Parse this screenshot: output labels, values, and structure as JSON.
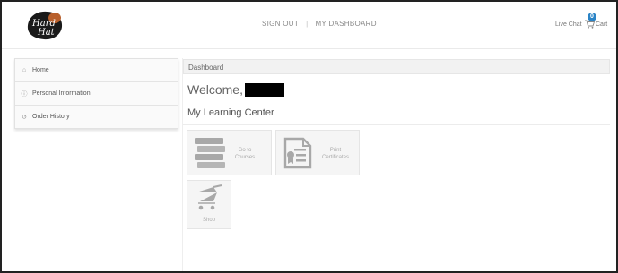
{
  "header": {
    "logo_text": "Hard Hat",
    "nav": [
      "SIGN OUT",
      "MY DASHBOARD"
    ],
    "nav_separator": "|",
    "live_chat": "Live Chat",
    "cart": {
      "label": "Cart",
      "count": "0"
    }
  },
  "sidebar": {
    "items": [
      {
        "label": "Home",
        "icon": "home-icon"
      },
      {
        "label": "Personal Information",
        "icon": "info-icon"
      },
      {
        "label": "Order History",
        "icon": "history-icon"
      }
    ]
  },
  "main": {
    "breadcrumb": "Dashboard",
    "welcome": "Welcome,",
    "section_title": "My Learning Center",
    "tiles": [
      {
        "line1": "Go to",
        "line2": "Courses",
        "icon": "books-icon"
      },
      {
        "line1": "Print",
        "line2": "Certificates",
        "icon": "certificate-icon"
      },
      {
        "line1": "Shop",
        "line2": "",
        "icon": "shopping-cart-icon"
      }
    ]
  },
  "colors": {
    "accent": "#2b84c6",
    "tile_icon": "#a8a8a8",
    "redaction": "#000000"
  }
}
